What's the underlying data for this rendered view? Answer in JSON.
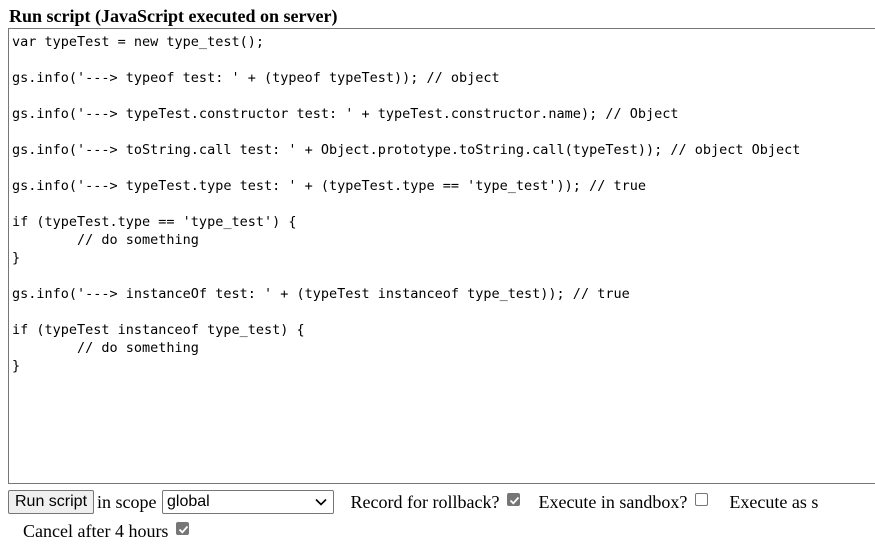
{
  "header": {
    "title": "Run script (JavaScript executed on server)"
  },
  "script": {
    "lines": [
      "var typeTest = new type_test();",
      "",
      "gs.info('---> typeof test: ' + (typeof typeTest)); // object",
      "",
      "gs.info('---> typeTest.constructor test: ' + typeTest.constructor.name); // Object",
      "",
      "gs.info('---> toString.call test: ' + Object.prototype.toString.call(typeTest)); // object Object",
      "",
      "gs.info('---> typeTest.type test: ' + (typeTest.type == 'type_test')); // true",
      "",
      "if (typeTest.type == 'type_test') {",
      "        // do something",
      "}",
      "",
      "gs.info('---> instanceOf test: ' + (typeTest instanceof type_test)); // true",
      "",
      "if (typeTest instanceof type_test) {",
      "        // do something",
      "}"
    ]
  },
  "controls": {
    "run_button_label": "Run script",
    "scope_label": "in scope",
    "scope_value": "global",
    "rollback_label": "Record for rollback?",
    "rollback_checked": true,
    "sandbox_label": "Execute in sandbox?",
    "sandbox_checked": false,
    "execute_as_label": "Execute as s",
    "cancel_label": "Cancel after 4 hours",
    "cancel_checked": true
  }
}
